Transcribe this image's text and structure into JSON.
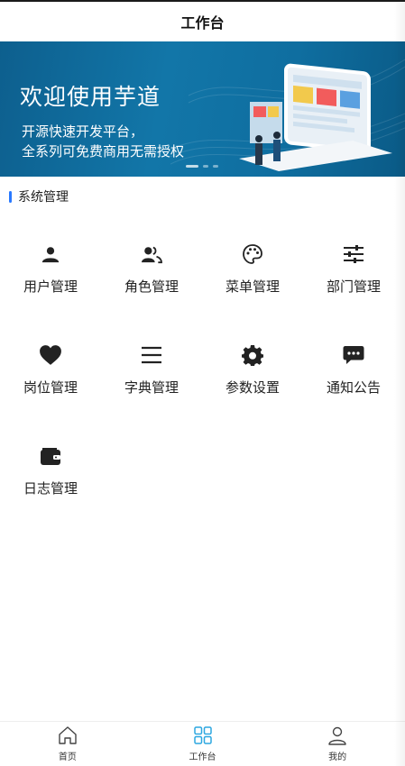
{
  "navbar": {
    "title": "工作台"
  },
  "banner": {
    "headline": "欢迎使用芋道",
    "line1": "开源快速开发平台，",
    "line2": "全系列可免费商用无需授权",
    "slide_count": 3,
    "active_slide": 1
  },
  "section": {
    "title": "系统管理",
    "accent": "#2979ff"
  },
  "menu": [
    {
      "label": "用户管理",
      "icon": "user-icon"
    },
    {
      "label": "角色管理",
      "icon": "users-icon"
    },
    {
      "label": "菜单管理",
      "icon": "palette-icon"
    },
    {
      "label": "部门管理",
      "icon": "settings-sliders-icon"
    },
    {
      "label": "岗位管理",
      "icon": "heart-icon"
    },
    {
      "label": "字典管理",
      "icon": "list-icon"
    },
    {
      "label": "参数设置",
      "icon": "gear-icon"
    },
    {
      "label": "通知公告",
      "icon": "chat-icon"
    },
    {
      "label": "日志管理",
      "icon": "wallet-icon"
    }
  ],
  "tabbar": {
    "items": [
      {
        "label": "首页",
        "icon": "home-icon"
      },
      {
        "label": "工作台",
        "icon": "grid-icon"
      },
      {
        "label": "我的",
        "icon": "person-icon"
      }
    ],
    "active_color": "#2da7e0"
  }
}
